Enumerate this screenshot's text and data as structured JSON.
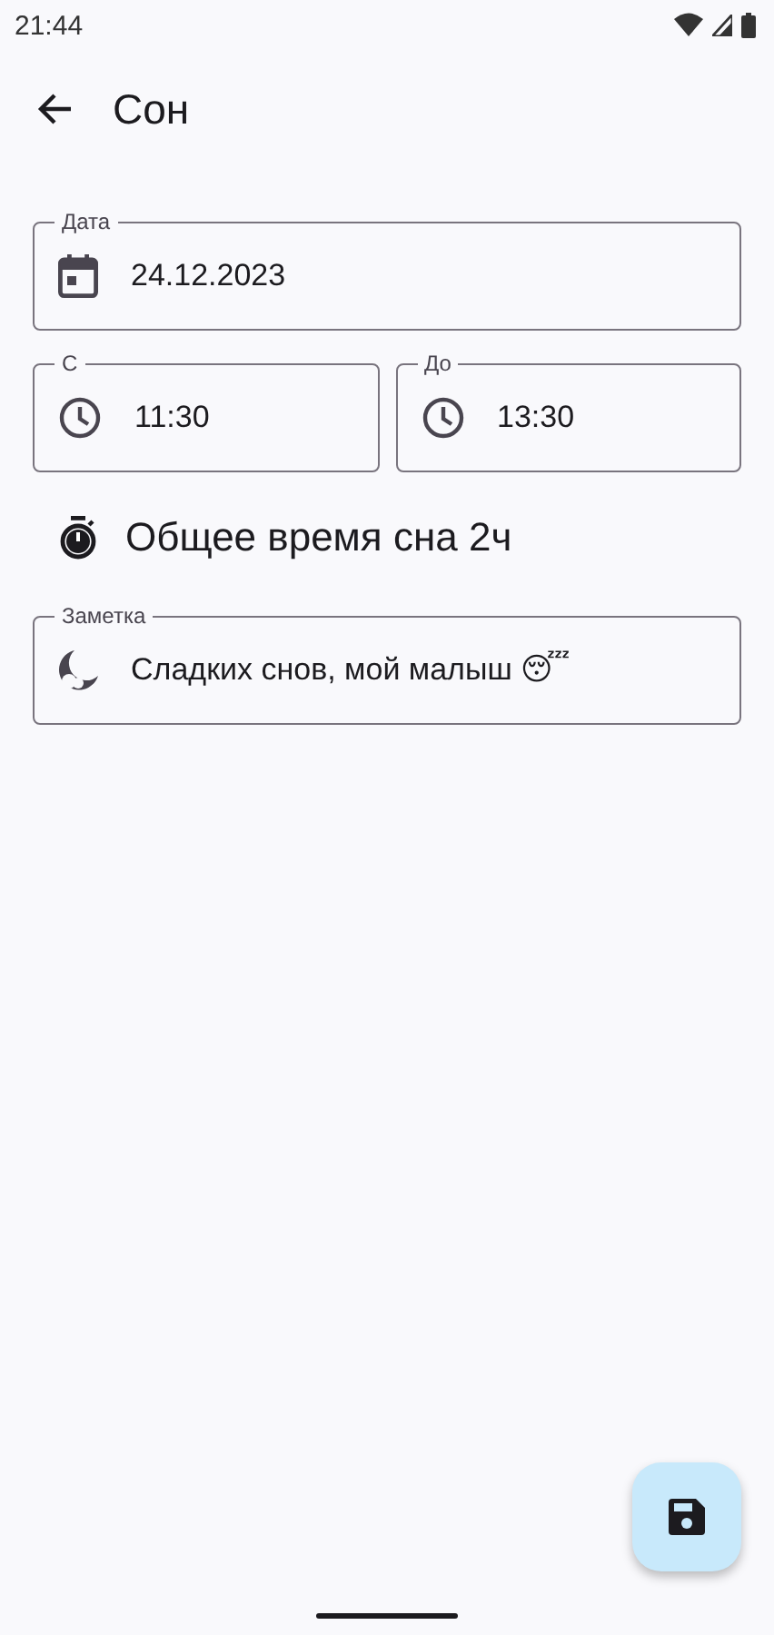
{
  "status_bar": {
    "time": "21:44"
  },
  "app_bar": {
    "title": "Сон"
  },
  "date_field": {
    "label": "Дата",
    "value": "24.12.2023"
  },
  "time_fields": [
    {
      "label": "С",
      "value": "11:30"
    },
    {
      "label": "До",
      "value": "13:30"
    }
  ],
  "total": {
    "text": "Общее время сна 2ч"
  },
  "note_field": {
    "label": "Заметка",
    "value": "Сладких снов, мой малыш 😴"
  }
}
